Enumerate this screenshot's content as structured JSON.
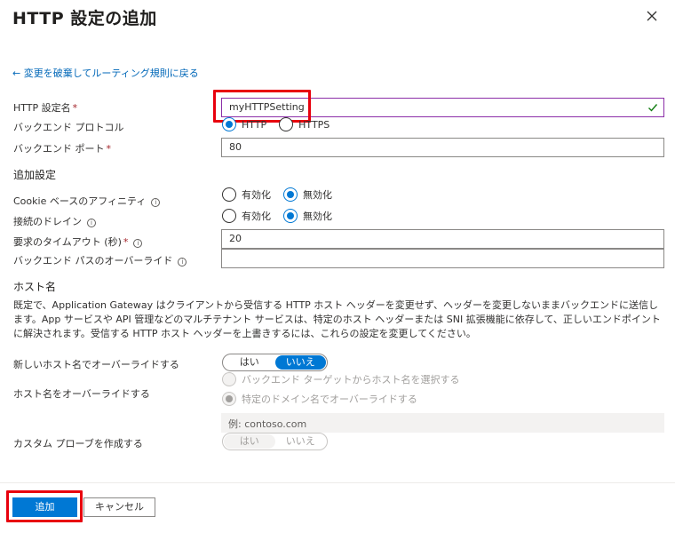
{
  "header": {
    "title": "HTTP 設定の追加",
    "close_icon": "close-icon"
  },
  "back_link": "← 変更を破棄してルーティング規則に戻る",
  "fields": {
    "setting_name": {
      "label": "HTTP 設定名",
      "required": "*",
      "value": "myHTTPSetting",
      "valid_icon": "checkmark-icon"
    },
    "backend_protocol": {
      "label": "バックエンド プロトコル",
      "options": [
        "HTTP",
        "HTTPS"
      ],
      "selected": "HTTP"
    },
    "backend_port": {
      "label": "バックエンド ポート",
      "required": "*",
      "value": "80"
    }
  },
  "additional": {
    "heading": "追加設定",
    "cookie_affinity": {
      "label": "Cookie ベースのアフィニティ",
      "info": "i",
      "options": [
        "有効化",
        "無効化"
      ],
      "selected": "無効化"
    },
    "connection_draining": {
      "label": "接続のドレイン",
      "info": "i",
      "options": [
        "有効化",
        "無効化"
      ],
      "selected": "無効化"
    },
    "request_timeout": {
      "label": "要求のタイムアウト (秒)",
      "required": "*",
      "info": "i",
      "value": "20"
    },
    "override_path": {
      "label": "バックエンド パスのオーバーライド",
      "info": "i",
      "value": ""
    }
  },
  "host": {
    "heading": "ホスト名",
    "description": "既定で、Application Gateway はクライアントから受信する HTTP ホスト ヘッダーを変更せず、ヘッダーを変更しないままバックエンドに送信します。App サービスや API 管理などのマルチテナント サービスは、特定のホスト ヘッダーまたは SNI 拡張機能に依存して、正しいエンドポイントに解決されます。受信する HTTP ホスト ヘッダーを上書きするには、これらの設定を変更してください。",
    "override_new_host": {
      "label": "新しいホスト名でオーバーライドする",
      "options": [
        "はい",
        "いいえ"
      ],
      "selected": "いいえ"
    },
    "override_host": {
      "label": "ホスト名をオーバーライドする",
      "options": [
        "バックエンド ターゲットからホスト名を選択する",
        "特定のドメイン名でオーバーライドする"
      ],
      "selected": "特定のドメイン名でオーバーライドする",
      "placeholder": "例: contoso.com"
    },
    "custom_probe": {
      "label": "カスタム プローブを作成する",
      "options": [
        "はい",
        "いいえ"
      ],
      "selected": "はい"
    }
  },
  "footer": {
    "add_label": "追加",
    "cancel_label": "キャンセル"
  },
  "colors": {
    "accent": "#0078d4",
    "highlight": "#e8000d",
    "link": "#0067b8",
    "required": "#a4262c",
    "valid": "#107c10"
  }
}
